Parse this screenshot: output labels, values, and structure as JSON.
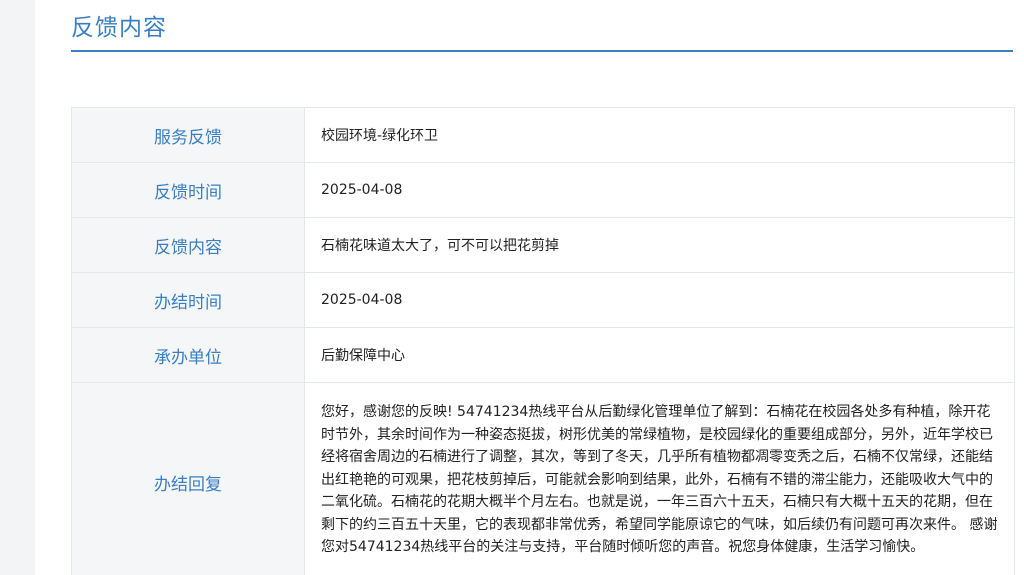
{
  "header": {
    "title": "反馈内容"
  },
  "rows": [
    {
      "label": "服务反馈",
      "value": "校园环境-绿化环卫"
    },
    {
      "label": "反馈时间",
      "value": "2025-04-08"
    },
    {
      "label": "反馈内容",
      "value": "石楠花味道太大了，可不可以把花剪掉"
    },
    {
      "label": "办结时间",
      "value": "2025-04-08"
    },
    {
      "label": "承办单位",
      "value": "后勤保障中心"
    },
    {
      "label": "办结回复",
      "value": "您好，感谢您的反映! 54741234热线平台从后勤绿化管理单位了解到：石楠花在校园各处多有种植，除开花时节外，其余时间作为一种姿态挺拔，树形优美的常绿植物，是校园绿化的重要组成部分，另外，近年学校已经将宿舍周边的石楠进行了调整，其次，等到了冬天，几乎所有植物都凋零变秃之后，石楠不仅常绿，还能结出红艳艳的可观果，把花枝剪掉后，可能就会影响到结果，此外，石楠有不错的滞尘能力，还能吸收大气中的二氧化硫。石楠花的花期大概半个月左右。也就是说，一年三百六十五天，石楠只有大概十五天的花期，但在剩下的约三百五十天里，它的表现都非常优秀，希望同学能原谅它的气味，如后续仍有问题可再次来件。 感谢您对54741234热线平台的关注与支持，平台随时倾听您的声音。祝您身体健康，生活学习愉快。"
    }
  ]
}
